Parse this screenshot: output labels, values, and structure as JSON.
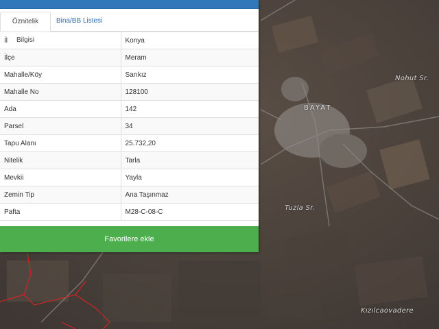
{
  "tabs": [
    {
      "label": "Öznitelik Bilgisi",
      "active": true
    },
    {
      "label": "Bina/BB Listesi",
      "active": false
    }
  ],
  "attributes": [
    {
      "key": "İl",
      "value": "Konya"
    },
    {
      "key": "İlçe",
      "value": "Meram"
    },
    {
      "key": "Mahalle/Köy",
      "value": "Sarıkız"
    },
    {
      "key": "Mahalle No",
      "value": "128100"
    },
    {
      "key": "Ada",
      "value": "142"
    },
    {
      "key": "Parsel",
      "value": "34"
    },
    {
      "key": "Tapu Alanı",
      "value": "25.732,20"
    },
    {
      "key": "Nitelik",
      "value": "Tarla"
    },
    {
      "key": "Mevkii",
      "value": "Yayla"
    },
    {
      "key": "Zemin Tip",
      "value": "Ana Taşınmaz"
    },
    {
      "key": "Pafta",
      "value": "M28-C-08-C"
    }
  ],
  "favorite_button": "Favorilere ekle",
  "map_labels": {
    "nohut": "Nohut Sr.",
    "bayat": "BAYAT",
    "tuzla": "Tuzla Sr.",
    "kizilcaovadere": "Kızılcaovadere"
  },
  "colors": {
    "header": "#2f77b9",
    "button": "#4cae4c",
    "parcel_outline": "#d02525"
  }
}
